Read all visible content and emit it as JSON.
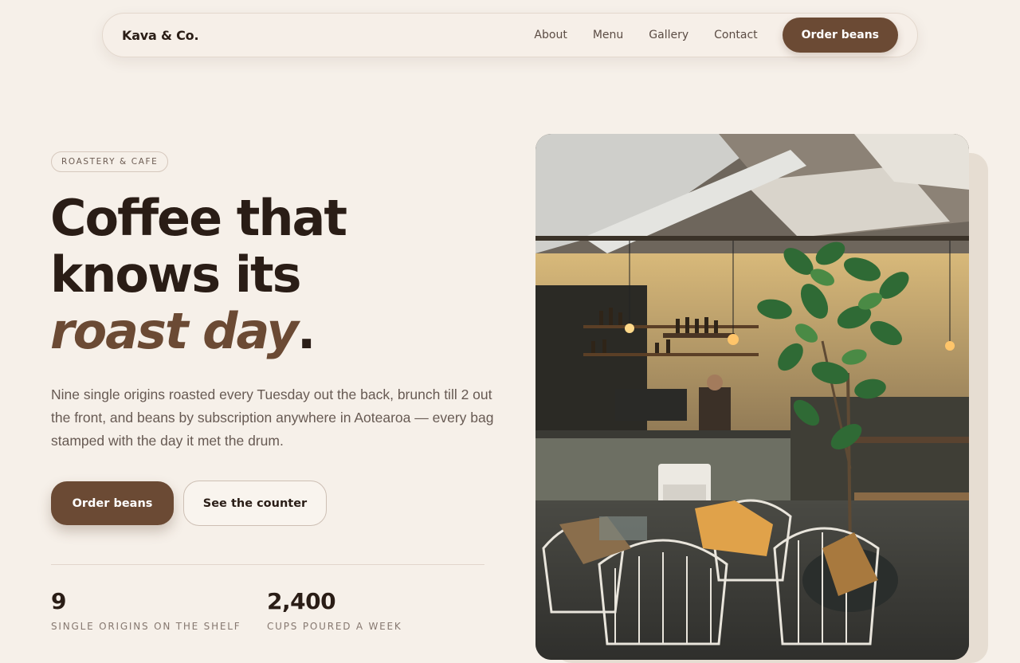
{
  "nav": {
    "brand": "Kava & Co.",
    "links": [
      "About",
      "Menu",
      "Gallery",
      "Contact"
    ],
    "cta": "Order beans"
  },
  "hero": {
    "eyebrow": "ROASTERY & CAFE",
    "headline_line1": "Coffee that",
    "headline_line2": "knows its",
    "headline_accent": "roast day",
    "headline_end": ".",
    "lede": "Nine single origins roasted every Tuesday out the back, brunch till 2 out the front, and beans by subscription anywhere in Aotearoa — every bag stamped with the day it met the drum.",
    "primary_cta": "Order beans",
    "secondary_cta": "See the counter",
    "stats": [
      {
        "value": "9",
        "label": "SINGLE ORIGINS ON THE SHELF"
      },
      {
        "value": "2,400",
        "label": "CUPS POURED A WEEK"
      }
    ]
  },
  "colors": {
    "background": "#f6f0e9",
    "accent": "#6b4a34",
    "ink": "#2a1d16"
  }
}
